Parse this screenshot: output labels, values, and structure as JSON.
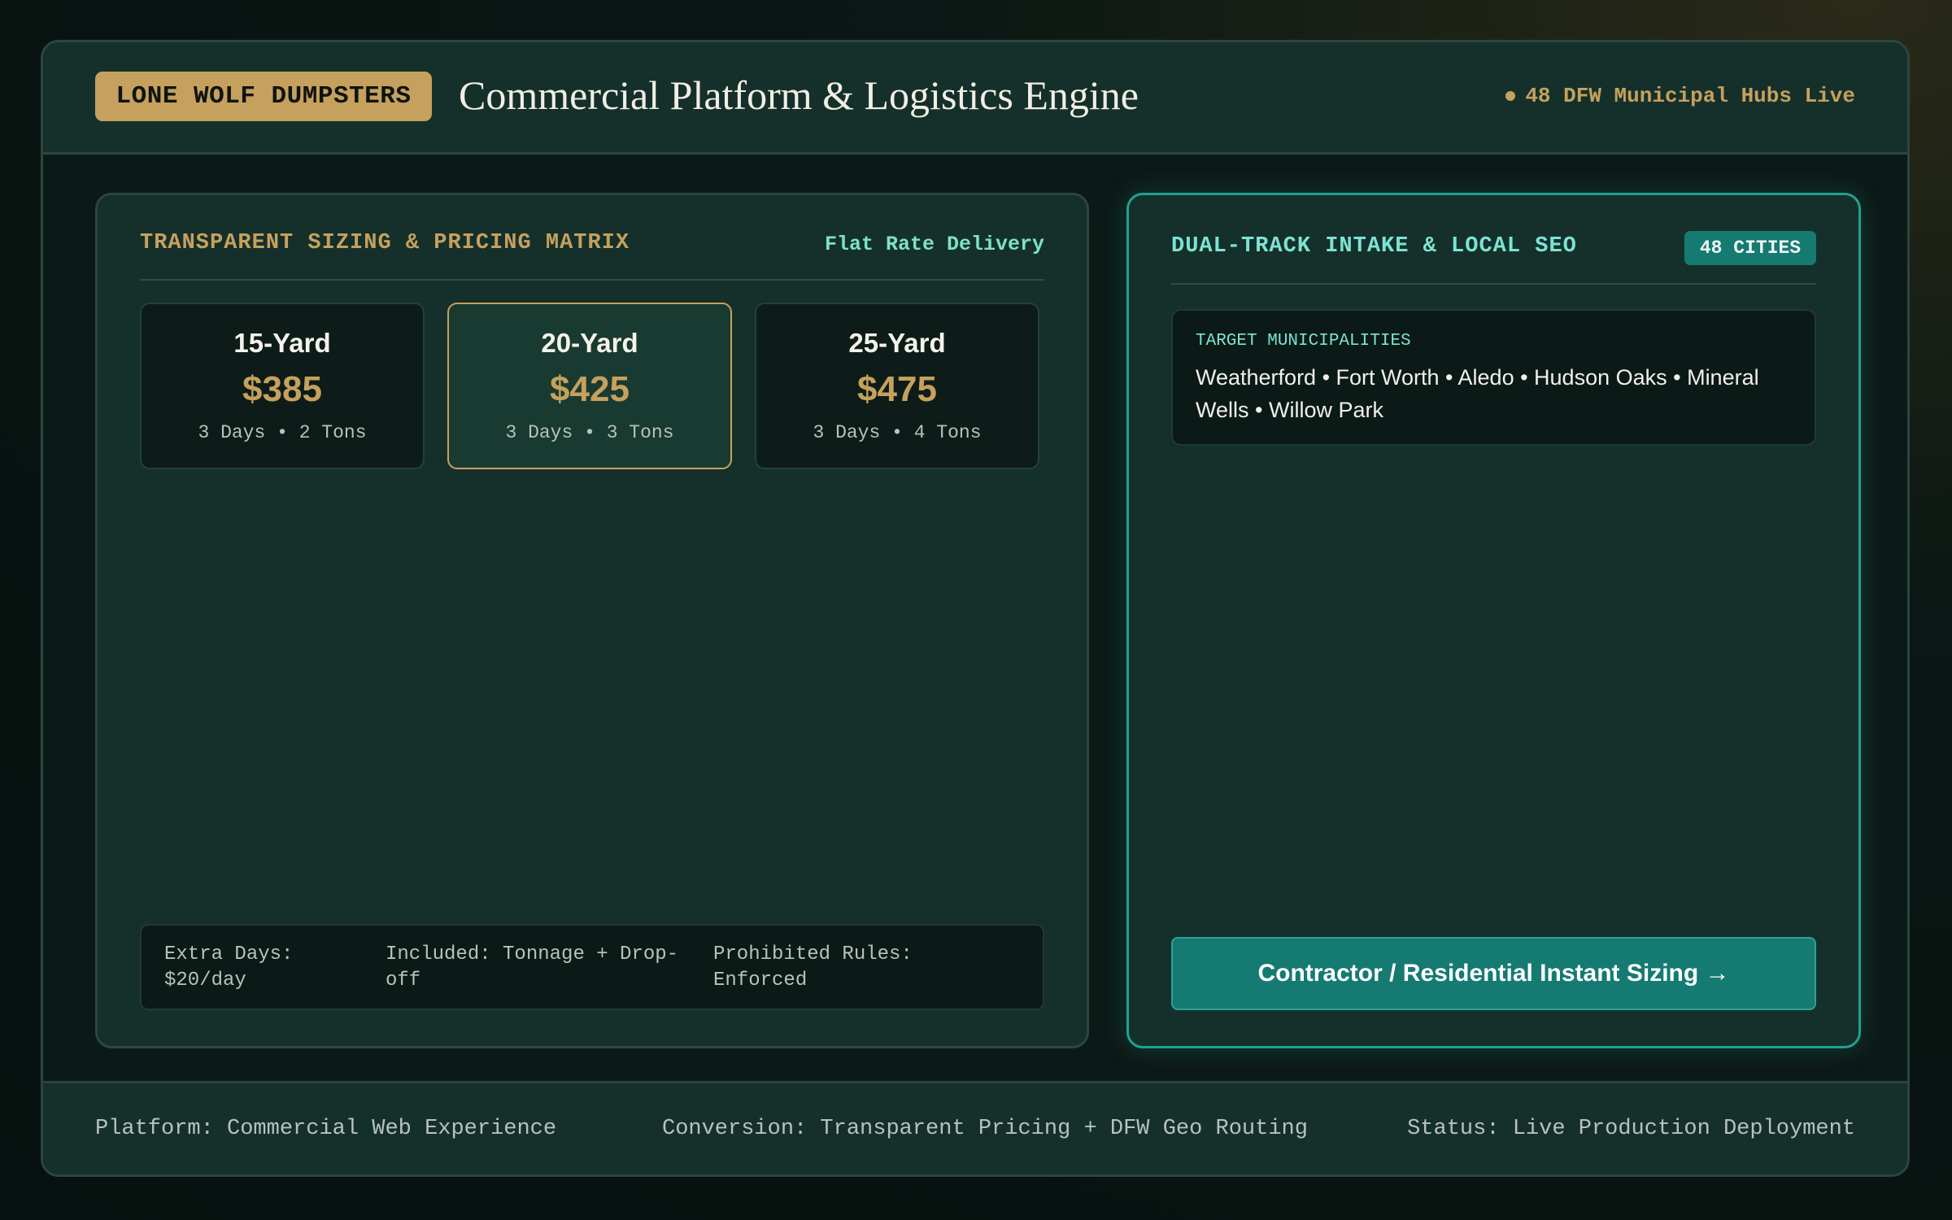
{
  "header": {
    "brand": "LONE WOLF DUMPSTERS",
    "title": "Commercial Platform & Logistics Engine",
    "hub_status": "48 DFW Municipal Hubs Live"
  },
  "pricing": {
    "title": "TRANSPARENT SIZING & PRICING MATRIX",
    "tag": "Flat Rate Delivery",
    "sizes": [
      {
        "name": "15-Yard",
        "price": "$385",
        "meta": "3 Days • 2 Tons"
      },
      {
        "name": "20-Yard",
        "price": "$425",
        "meta": "3 Days • 3 Tons"
      },
      {
        "name": "25-Yard",
        "price": "$475",
        "meta": "3 Days • 4 Tons"
      }
    ],
    "policies": {
      "extra_days": "Extra Days: $20/day",
      "included": "Included: Tonnage + Drop-off",
      "prohibited": "Prohibited Rules: Enforced"
    }
  },
  "intake": {
    "title": "DUAL-TRACK INTAKE & LOCAL SEO",
    "badge": "48 CITIES",
    "municipalities_label": "TARGET MUNICIPALITIES",
    "municipalities": "Weatherford • Fort Worth • Aledo • Hudson Oaks • Mineral Wells • Willow Park",
    "cta_label": "Contractor / Residential Instant Sizing →"
  },
  "footer": {
    "platform": "Platform: Commercial Web Experience",
    "conversion": "Conversion: Transparent Pricing + DFW Geo Routing",
    "status": "Status: Live Production Deployment"
  },
  "colors": {
    "accent_gold": "#c5a15d",
    "accent_teal": "#157a72",
    "panel_bg": "#15302b"
  }
}
